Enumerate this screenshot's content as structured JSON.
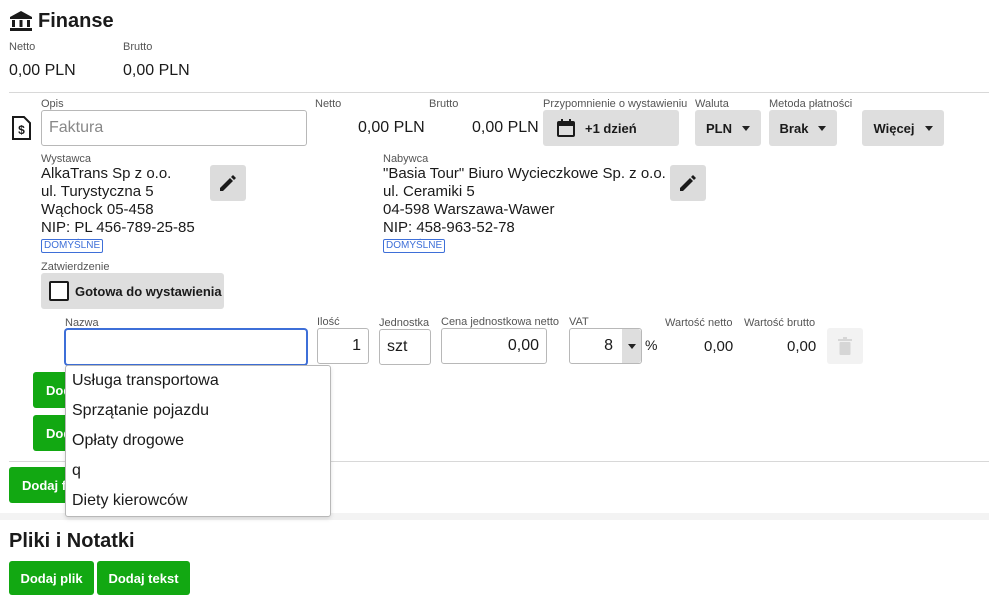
{
  "finance": {
    "title": "Finanse",
    "netto_label": "Netto",
    "netto_value": "0,00 PLN",
    "brutto_label": "Brutto",
    "brutto_value": "0,00 PLN"
  },
  "invoice": {
    "opis_label": "Opis",
    "opis_placeholder": "Faktura",
    "netto_label": "Netto",
    "netto_value": "0,00 PLN",
    "brutto_label": "Brutto",
    "brutto_value": "0,00 PLN",
    "reminder_label": "Przypomnienie o wystawieniu",
    "reminder_value": "+1 dzień",
    "currency_label": "Waluta",
    "currency_value": "PLN",
    "payment_label": "Metoda płatności",
    "payment_value": "Brak",
    "more_label": "Więcej"
  },
  "seller": {
    "label": "Wystawca",
    "lines": [
      "AlkaTrans Sp z o.o.",
      "ul. Turystyczna 5",
      "Wąchock 05-458",
      "NIP: PL 456-789-25-85"
    ],
    "default_tag": "DOMYŚLNE"
  },
  "buyer": {
    "label": "Nabywca",
    "lines": [
      "\"Basia Tour\" Biuro Wycieczkowe Sp. z o.o.",
      "ul. Ceramiki 5",
      "04-598 Warszawa-Wawer",
      "NIP: 458-963-52-78"
    ],
    "default_tag": "DOMYŚLNE"
  },
  "approval": {
    "label": "Zatwierdzenie",
    "checkbox_label": "Gotowa do wystawienia",
    "checked": false
  },
  "line_item": {
    "name_label": "Nazwa",
    "name_value": "",
    "qty_label": "Ilość",
    "qty_value": "1",
    "unit_label": "Jednostka",
    "unit_value": "szt",
    "unit_price_label": "Cena jednostkowa netto",
    "unit_price_value": "0,00",
    "vat_label": "VAT",
    "vat_value": "8",
    "vat_unit": "%",
    "net_total_label": "Wartość netto",
    "net_total_value": "0,00",
    "gross_total_label": "Wartość brutto",
    "gross_total_value": "0,00"
  },
  "suggestions": [
    "Usługa transportowa",
    "Sprzątanie pojazdu",
    "Opłaty drogowe",
    "q",
    "Diety kierowców"
  ],
  "buttons": {
    "add_1_visible": "Dod",
    "add_2_visible": "Dod",
    "add_invoice_visible": "Dodaj f"
  },
  "files": {
    "title": "Pliki i Notatki",
    "add_file": "Dodaj plik",
    "add_text": "Dodaj tekst"
  },
  "colors": {
    "accent_green": "#12a812",
    "link_blue": "#3e6fd8",
    "button_grey": "#dedede"
  }
}
